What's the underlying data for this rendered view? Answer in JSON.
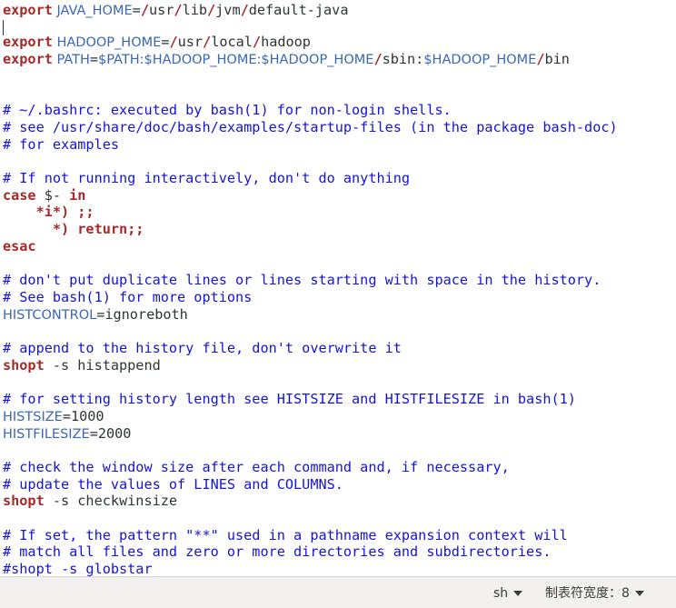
{
  "editor": {
    "l1": {
      "a": "export",
      "b": " JAVA_HOME",
      "c": "=",
      "d": "/",
      "e": "usr",
      "f": "/",
      "g": "lib",
      "h": "/",
      "i": "jvm",
      "j": "/",
      "k": "default-java"
    },
    "l3": {
      "a": "export",
      "b": " HADOOP_HOME",
      "c": "=",
      "d": "/",
      "e": "usr",
      "f": "/",
      "g": "local",
      "h": "/",
      "i": "hadoop"
    },
    "l4": {
      "a": "export",
      "b": " PATH",
      "c": "=",
      "d": "$PATH:$HADOOP_HOME:$HADOOP_HOME",
      "e": "/",
      "f": "sbin:",
      "g": "$HADOOP_HOME",
      "h": "/",
      "i": "bin"
    },
    "l7": "# ~/.bashrc: executed by bash(1) for non-login shells.",
    "l8": "# see /usr/share/doc/bash/examples/startup-files (in the package bash-doc)",
    "l9": "# for examples",
    "l11": "# If not running interactively, don't do anything",
    "l12": {
      "a": "case",
      "b": " $-",
      "c": " in"
    },
    "l13": {
      "a": "    *i*) ;;"
    },
    "l14": {
      "a": "      *) return;;"
    },
    "l15": {
      "a": "esac"
    },
    "l17": "# don't put duplicate lines or lines starting with space in the history.",
    "l18": "# See bash(1) for more options",
    "l19": {
      "a": "HISTCONTROL",
      "b": "=",
      "c": "ignoreboth"
    },
    "l21": "# append to the history file, don't overwrite it",
    "l22": {
      "a": "shopt",
      "b": " -s histappend"
    },
    "l24": "# for setting history length see HISTSIZE and HISTFILESIZE in bash(1)",
    "l25": {
      "a": "HISTSIZE",
      "b": "=",
      "c": "1000"
    },
    "l26": {
      "a": "HISTFILESIZE",
      "b": "=",
      "c": "2000"
    },
    "l28": "# check the window size after each command and, if necessary,",
    "l29": "# update the values of LINES and COLUMNS.",
    "l30": {
      "a": "shopt",
      "b": " -s checkwinsize"
    },
    "l32": "# If set, the pattern \"**\" used in a pathname expansion context will",
    "l33": "# match all files and zero or more directories and subdirectories.",
    "l34": "#shopt -s globstar"
  },
  "statusbar": {
    "language": "sh",
    "tab_width_label": "制表符宽度：",
    "tab_width_value": "8"
  },
  "icons": {
    "dropdown": "chevron-down-icon"
  },
  "colors": {
    "keyword": "#a52a2a",
    "comment": "#1414d6",
    "variable": "#3a67b5",
    "text": "#2e3436",
    "statusbar_bg": "#f2f1f0"
  }
}
